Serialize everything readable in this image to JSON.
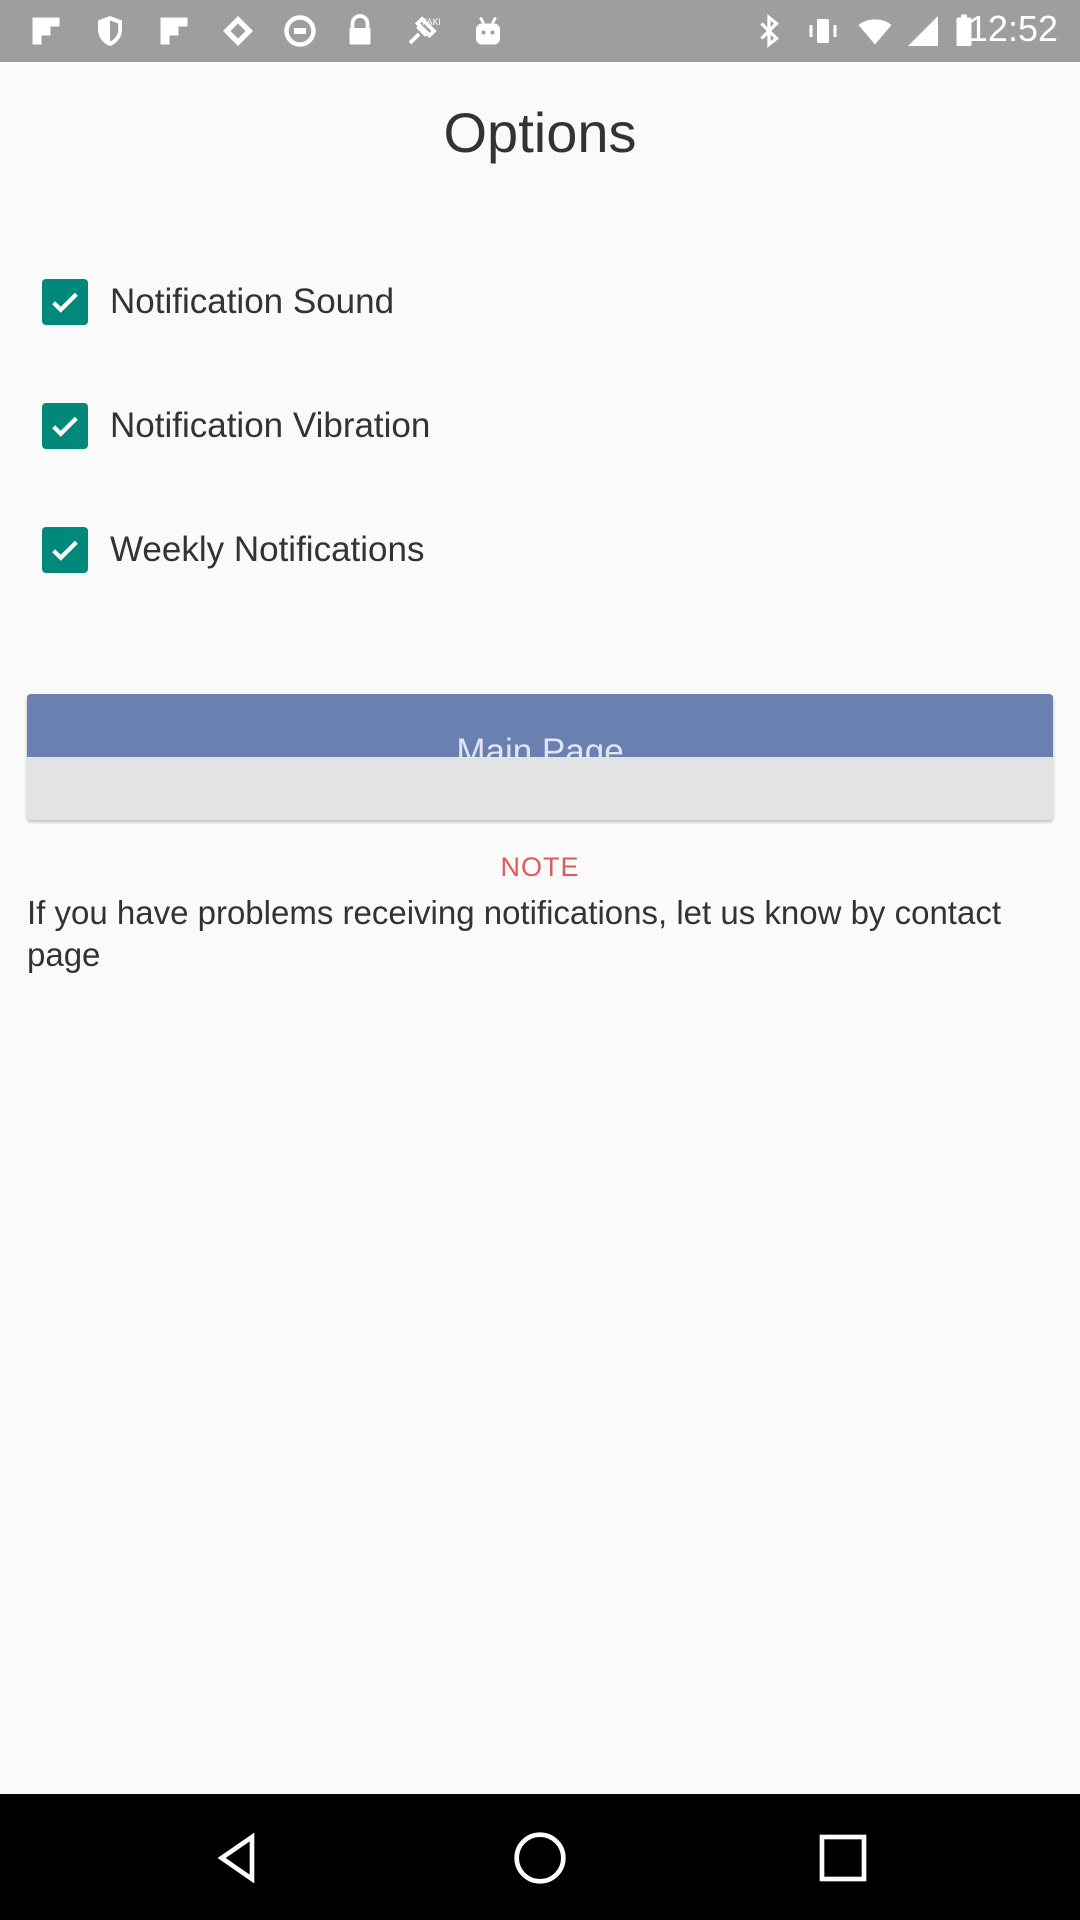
{
  "status_bar": {
    "time": "12:52",
    "left_icons": [
      "flipboard-icon",
      "shield-icon",
      "flipboard-icon",
      "puzzle-icon",
      "settings-icon",
      "lock-icon",
      "satellite-icon",
      "android-icon"
    ],
    "right_icons": [
      "bluetooth-icon",
      "vibrate-icon",
      "wifi-icon",
      "signal-icon",
      "battery-icon"
    ]
  },
  "page": {
    "title": "Options",
    "options": [
      {
        "label": "Notification Sound",
        "checked": true
      },
      {
        "label": "Notification Vibration",
        "checked": true
      },
      {
        "label": "Weekly Notifications",
        "checked": true
      }
    ],
    "main_button_label": "Main Page",
    "note_title": "NOTE",
    "note_text": "If you have problems receiving notifications, let us know by contact page"
  },
  "colors": {
    "checkbox": "#00897b",
    "button_top": "#6980b1",
    "button_bottom": "#e2e3e4",
    "note_title": "#e05a5a"
  },
  "nav_bar": {
    "buttons": [
      "back-icon",
      "home-icon",
      "recents-icon"
    ]
  }
}
